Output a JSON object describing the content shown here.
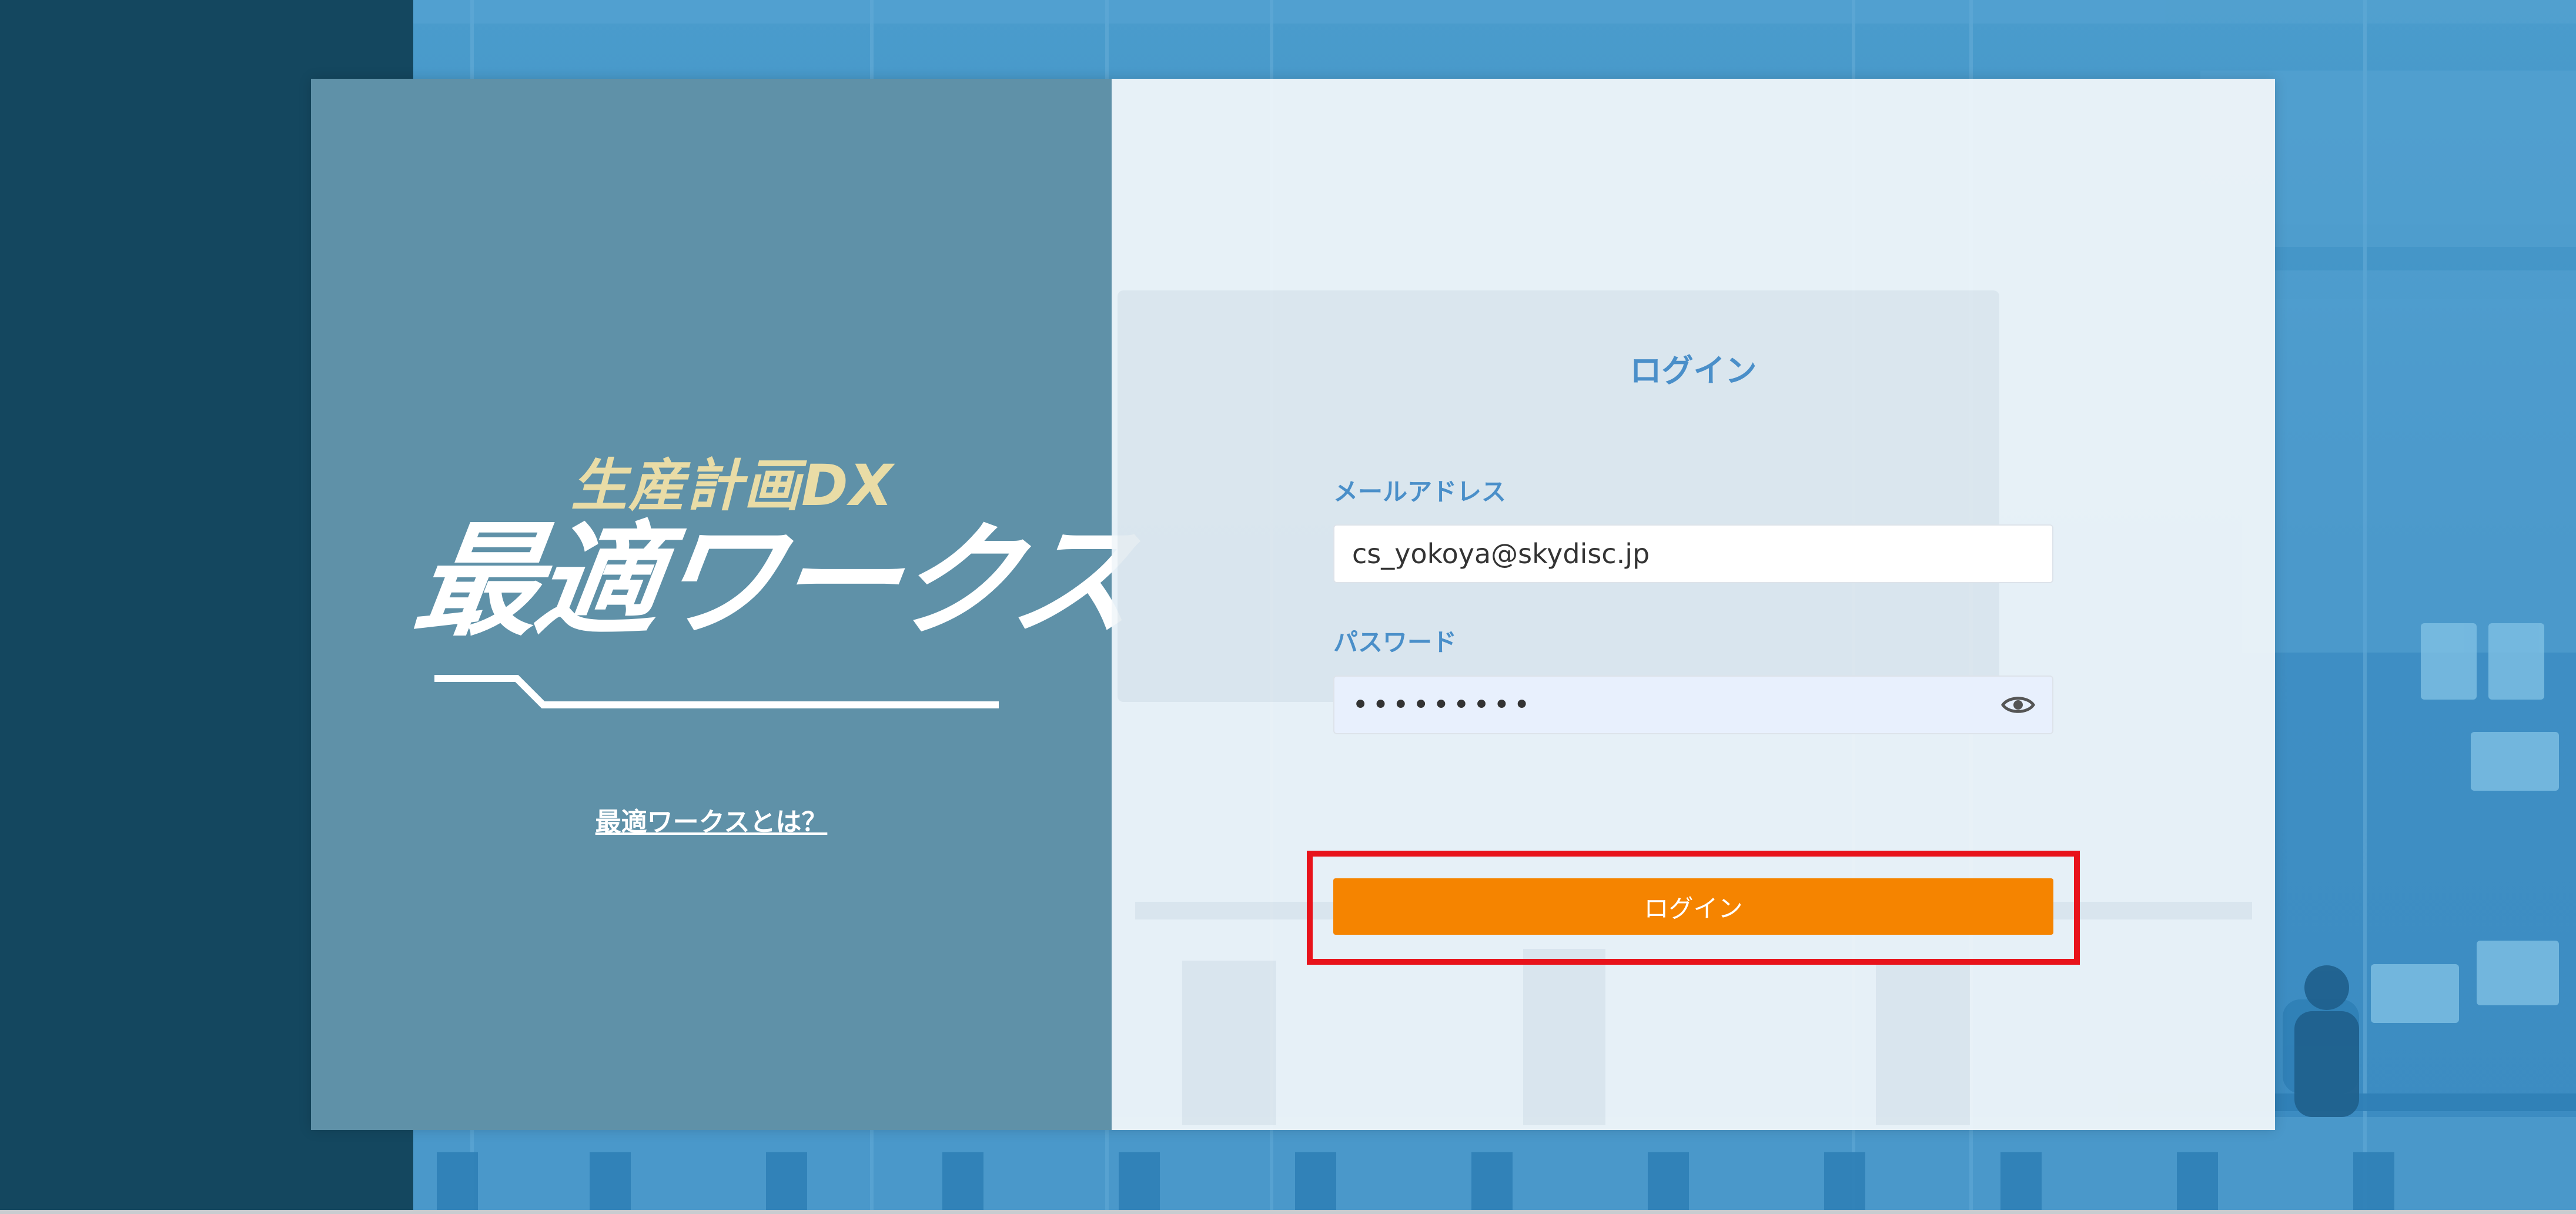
{
  "branding": {
    "subtitle": "生産計画DX",
    "title": "最適ワークス",
    "about_link": "最適ワークスとは？"
  },
  "login_form": {
    "title": "ログイン",
    "email_label": "メールアドレス",
    "email_value": "cs_yokoya@skydisc.jp",
    "password_label": "パスワード",
    "password_value": "•••••••••",
    "submit_label": "ログイン"
  },
  "icons": {
    "password_toggle": "eye-icon"
  },
  "colors": {
    "sidebar_dark": "#14475f",
    "brand_panel": "#5f91a8",
    "accent_blue": "#4a8fc9",
    "button_orange": "#f58400",
    "highlight_red": "#e8131b",
    "logo_subtitle": "#e9dca6"
  }
}
